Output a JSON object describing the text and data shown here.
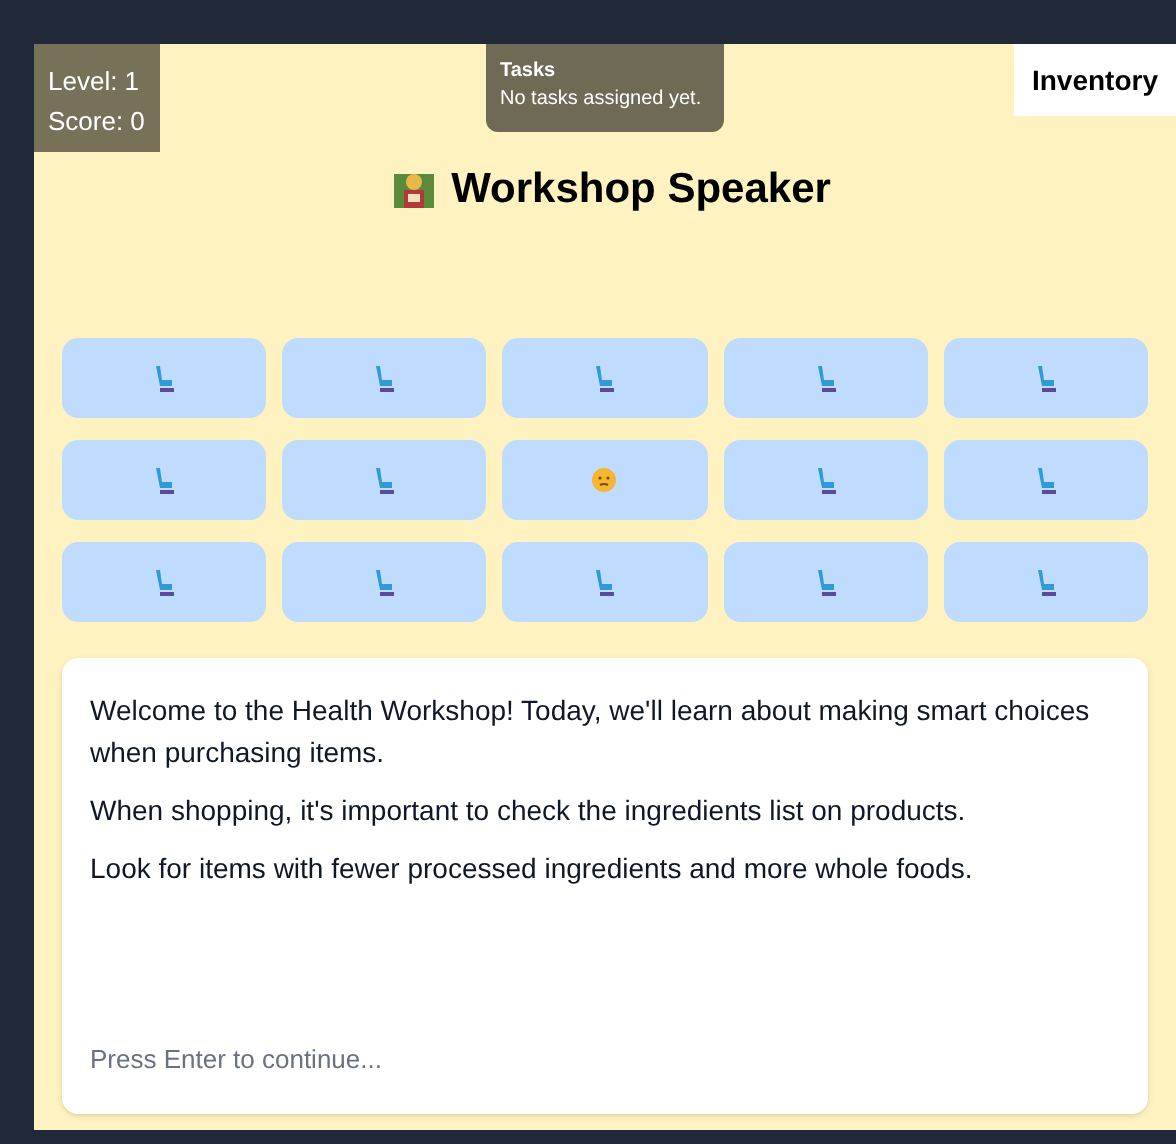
{
  "stats": {
    "level": "Level: 1",
    "score": "Score: 0"
  },
  "tasks": {
    "title": "Tasks",
    "text": "No tasks assigned yet."
  },
  "inventory_button": "Inventory",
  "title": "Workshop Speaker",
  "seats": [
    {
      "kind": "seat"
    },
    {
      "kind": "seat"
    },
    {
      "kind": "seat"
    },
    {
      "kind": "seat"
    },
    {
      "kind": "seat"
    },
    {
      "kind": "seat"
    },
    {
      "kind": "seat"
    },
    {
      "kind": "person"
    },
    {
      "kind": "seat"
    },
    {
      "kind": "seat"
    },
    {
      "kind": "seat"
    },
    {
      "kind": "seat"
    },
    {
      "kind": "seat"
    },
    {
      "kind": "seat"
    },
    {
      "kind": "seat"
    }
  ],
  "dialogue": {
    "paragraphs": [
      "Welcome to the Health Workshop! Today, we'll learn about making smart choices when purchasing items.",
      "When shopping, it's important to check the ingredients list on products.",
      "Look for items with fewer processed ingredients and more whole foods."
    ],
    "prompt": "Press Enter to continue..."
  }
}
